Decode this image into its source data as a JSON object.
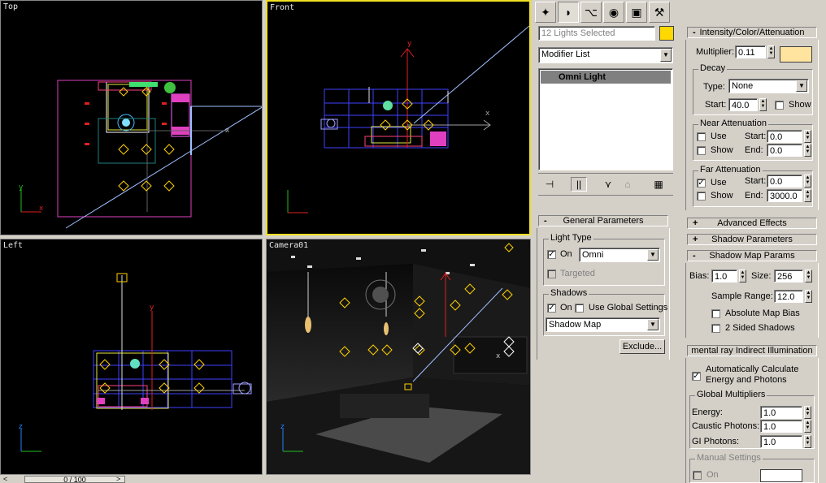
{
  "viewports": {
    "top": {
      "label": "Top"
    },
    "front": {
      "label": "Front"
    },
    "left": {
      "label": "Left"
    },
    "camera": {
      "label": "Camera01"
    }
  },
  "timeline": {
    "frame": "0 / 100"
  },
  "command_panel": {
    "tabs": [
      "create-icon",
      "modify-icon",
      "hierarchy-icon",
      "motion-icon",
      "display-icon",
      "utilities-icon"
    ],
    "selection_name": "12 Lights Selected",
    "selection_color": "#ffd800",
    "modifier_list": "Modifier List",
    "stack_item": "Omni Light",
    "toolbar_icons": [
      "pin-stack-icon",
      "show-end-result-icon",
      "make-unique-icon",
      "remove-modifier-icon",
      "configure-sets-icon"
    ]
  },
  "general": {
    "header": "General Parameters",
    "light_type_group": "Light Type",
    "on_label": "On",
    "light_type_value": "Omni",
    "targeted_label": "Targeted",
    "shadows_group": "Shadows",
    "shadows_on_label": "On",
    "use_global_label": "Use Global Settings",
    "shadow_type": "Shadow Map",
    "exclude_button": "Exclude..."
  },
  "intensity": {
    "header": "Intensity/Color/Attenuation",
    "multiplier_label": "Multiplier:",
    "multiplier_value": "0.11",
    "color": "#ffe4a0",
    "decay_group": "Decay",
    "type_label": "Type:",
    "type_value": "None",
    "start_label": "Start:",
    "start_value": "40.0",
    "show_label": "Show",
    "near_group": "Near Attenuation",
    "near_use": "Use",
    "near_show": "Show",
    "near_start_label": "Start:",
    "near_start": "0.0",
    "near_end_label": "End:",
    "near_end": "0.0",
    "far_group": "Far Attenuation",
    "far_use": "Use",
    "far_show": "Show",
    "far_start_label": "Start:",
    "far_start": "0.0",
    "far_end_label": "End:",
    "far_end": "3000.0"
  },
  "rollouts": {
    "advanced": "Advanced Effects",
    "shadow_params": "Shadow Parameters",
    "shadow_map": "Shadow Map Params"
  },
  "shadow_map": {
    "bias_label": "Bias:",
    "bias": "1.0",
    "size_label": "Size:",
    "size": "256",
    "sample_range_label": "Sample Range:",
    "sample_range": "12.0",
    "absolute_bias": "Absolute Map Bias",
    "two_sided": "2 Sided Shadows"
  },
  "mental_ray": {
    "header": "mental ray Indirect Illumination",
    "auto_calc": "Automatically Calculate Energy and Photons",
    "global_group": "Global Multipliers",
    "energy_label": "Energy:",
    "energy": "1.0",
    "caustic_label": "Caustic Photons:",
    "caustic": "1.0",
    "gi_label": "GI Photons:",
    "gi": "1.0",
    "manual_group": "Manual Settings",
    "manual_on": "On"
  }
}
